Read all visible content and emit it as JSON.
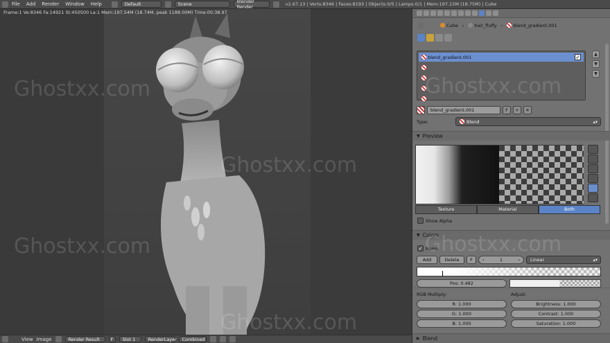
{
  "topbar": {
    "menu": [
      "File",
      "Add",
      "Render",
      "Window",
      "Help"
    ],
    "screen_layout": "Default",
    "scene": "Scene",
    "render_engine": "Blender Render",
    "stats": "v2.67.13 | Verts:8346 | Faces:8193 | Objects:0/5 | Lamps:0/1 | Mem:197.15M (18.75M) | Cube"
  },
  "viewport": {
    "info": "Frame:1 Ve:8346 Fa:14921 St:450500 La:1 Mem:197.54M (18.74M, peak 1188.00M) Time:00:38.97"
  },
  "watermark": "Ghostxx.com",
  "bottombar": {
    "items": [
      "View",
      "Image"
    ],
    "image_name": "Render Result",
    "f_label": "F",
    "slot": "Slot 1",
    "layer": "RenderLayer",
    "pass": "Combined"
  },
  "properties": {
    "breadcrumb": [
      "Cube",
      "hair_fluffy",
      "blend_gradient.001"
    ],
    "slots": [
      "blend_gradient.001",
      "",
      "",
      "",
      ""
    ],
    "slot_buttons": [
      "▲",
      "▼",
      "▼"
    ],
    "texture_name": "blend_gradient.001",
    "fake_user": "F",
    "type_label": "Type:",
    "type_value": "Blend",
    "preview_header": "Preview",
    "preview_tabs": [
      "Texture",
      "Material",
      "Both"
    ],
    "show_alpha": "Show Alpha",
    "colors_header": "Colors",
    "ramp_label": "Ramp",
    "add_button": "Add",
    "delete_button": "Delete",
    "f_button": "F",
    "active_stop": "1",
    "interpolation": "Linear",
    "pos_label": "Pos: 0.482",
    "rgb_multiply_label": "RGB Multiply:",
    "r_value": "R: 1.000",
    "g_value": "G: 1.000",
    "b_value": "B: 1.000",
    "adjust_label": "Adjust:",
    "brightness": "Brightness: 1.000",
    "contrast": "Contrast: 1.000",
    "saturation": "Saturation: 1.000",
    "blend_header": "Blend"
  }
}
